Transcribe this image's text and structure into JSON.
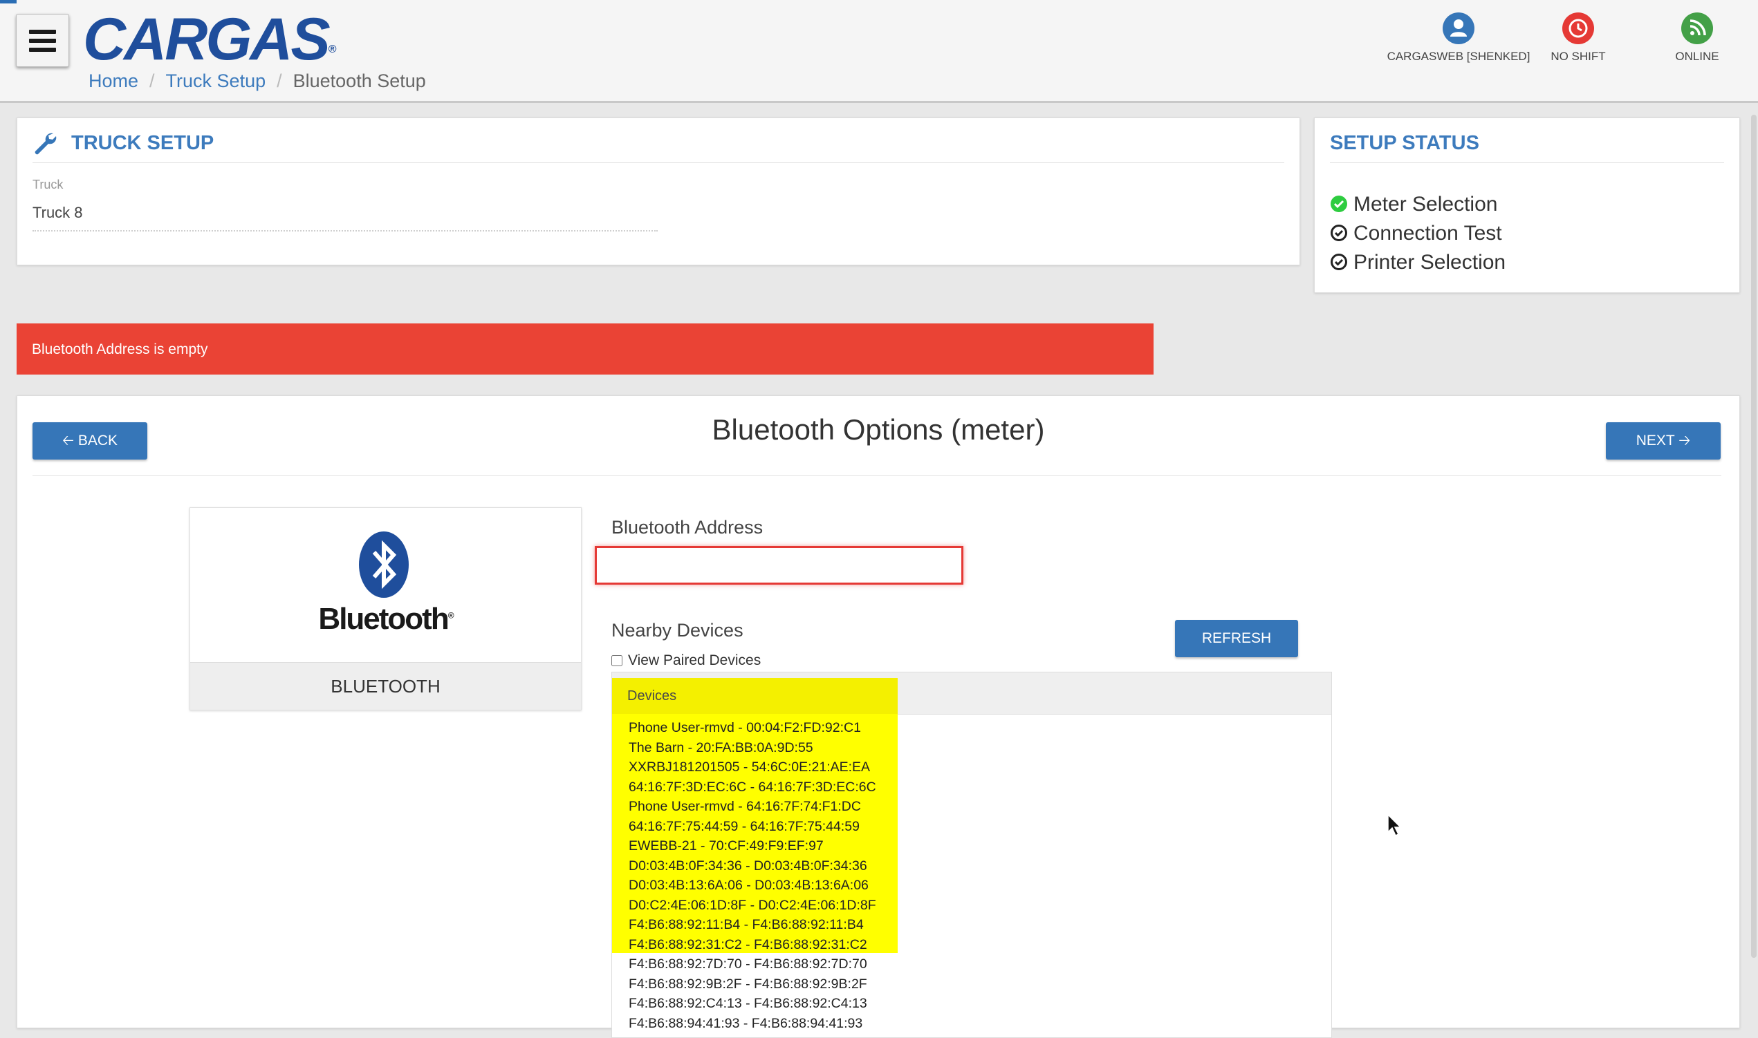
{
  "header": {
    "logo_text": "CARGAS",
    "logo_mark": "®",
    "menu_icon": "hamburger-menu-icon",
    "breadcrumb": {
      "home": "Home",
      "sep1": "/",
      "truck_setup": "Truck Setup",
      "sep2": "/",
      "current": "Bluetooth Setup"
    },
    "status": {
      "user": {
        "label": "CARGASWEB [SHENKED]",
        "icon": "user-icon",
        "color": "#3676b8"
      },
      "shift": {
        "label": "NO SHIFT",
        "icon": "clock-icon",
        "color": "#e53935"
      },
      "online": {
        "label": "ONLINE",
        "icon": "rss-icon",
        "color": "#43a047"
      }
    }
  },
  "truck_setup": {
    "title": "TRUCK SETUP",
    "icon": "wrench-icon",
    "truck_label": "Truck",
    "truck_value": "Truck 8"
  },
  "setup_status": {
    "title": "SETUP STATUS",
    "items": [
      {
        "label": "Meter Selection",
        "state": "done",
        "color": "#2ecc40"
      },
      {
        "label": "Connection Test",
        "state": "pending",
        "color": "#222222"
      },
      {
        "label": "Printer Selection",
        "state": "pending",
        "color": "#222222"
      }
    ]
  },
  "alert": {
    "message": "Bluetooth Address is empty",
    "color": "#ea4335"
  },
  "bluetooth_options": {
    "heading": "Bluetooth Options (meter)",
    "back_label": "BACK",
    "next_label": "NEXT",
    "back_icon": "arrow-left-icon",
    "next_icon": "arrow-right-icon",
    "card": {
      "logo_word": "Bluetooth",
      "logo_mark": "®",
      "label": "BLUETOOTH"
    },
    "address_label": "Bluetooth Address",
    "address_value": "",
    "nearby_label": "Nearby Devices",
    "refresh_label": "REFRESH",
    "view_paired_label": "View Paired Devices",
    "devices_header": "Devices",
    "highlight_color": "#ffff00",
    "devices": [
      "Phone User-rmvd - 00:04:F2:FD:92:C1",
      "The Barn - 20:FA:BB:0A:9D:55",
      "XXRBJ181201505 - 54:6C:0E:21:AE:EA",
      "64:16:7F:3D:EC:6C - 64:16:7F:3D:EC:6C",
      "Phone User-rmvd - 64:16:7F:74:F1:DC",
      "64:16:7F:75:44:59 - 64:16:7F:75:44:59",
      "EWEBB-21 - 70:CF:49:F9:EF:97",
      "D0:03:4B:0F:34:36 - D0:03:4B:0F:34:36",
      "D0:03:4B:13:6A:06 - D0:03:4B:13:6A:06",
      "D0:C2:4E:06:1D:8F - D0:C2:4E:06:1D:8F",
      "F4:B6:88:92:11:B4 - F4:B6:88:92:11:B4",
      "F4:B6:88:92:31:C2 - F4:B6:88:92:31:C2",
      "F4:B6:88:92:7D:70 - F4:B6:88:92:7D:70",
      "F4:B6:88:92:9B:2F - F4:B6:88:92:9B:2F",
      "F4:B6:88:92:C4:13 - F4:B6:88:92:C4:13",
      "F4:B6:88:94:41:93 - F4:B6:88:94:41:93"
    ]
  }
}
